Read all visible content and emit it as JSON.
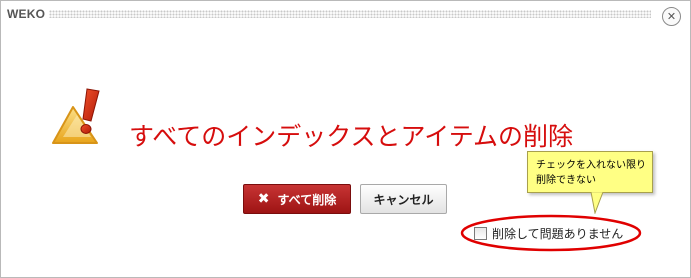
{
  "dialog": {
    "title": "WEKO",
    "close_icon": "close-circle-icon",
    "close_glyph": "✕"
  },
  "warning": {
    "icon": "warning-triangle-icon",
    "headline": "すべてのインデックスとアイテムの削除"
  },
  "buttons": {
    "delete_all_label": "すべて削除",
    "delete_icon": "x-icon",
    "delete_glyph": "✖",
    "cancel_label": "キャンセル"
  },
  "tooltip": {
    "line1": "チェックを入れない限り",
    "line2": "削除できない"
  },
  "confirm": {
    "checkbox_checked": false,
    "label": "削除して問題ありません"
  },
  "colors": {
    "headline": "#d60d0d",
    "delete_button": "#b52222",
    "tooltip_bg": "#ffff84",
    "highlight_ellipse": "#e00000",
    "warning_icon": "#f2c230"
  }
}
